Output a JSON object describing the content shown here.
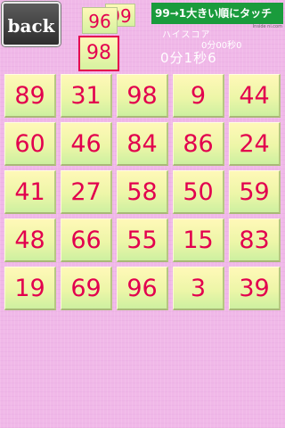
{
  "back_button": {
    "label": "back"
  },
  "recent_numbers": {
    "top": "98",
    "middle": "96",
    "back": "99"
  },
  "instruction": "99→1大きい順にタッチ",
  "ad_credit": "Inside ni.com",
  "hiscore": {
    "label": "ハイスコア",
    "value": "0分00秒0"
  },
  "timer": "0分1秒6",
  "board": {
    "rows": [
      [
        "89",
        "31",
        "98",
        "9",
        "44"
      ],
      [
        "60",
        "46",
        "84",
        "86",
        "24"
      ],
      [
        "41",
        "27",
        "58",
        "50",
        "59"
      ],
      [
        "48",
        "66",
        "55",
        "15",
        "83"
      ],
      [
        "19",
        "69",
        "96",
        "3",
        "39"
      ]
    ]
  },
  "colors": {
    "background": "#f0b8e8",
    "tile_text": "#e2004e",
    "banner": "#1a9b3c",
    "tile_top": "#fff8b8",
    "tile_bottom": "#cdf0a0"
  }
}
